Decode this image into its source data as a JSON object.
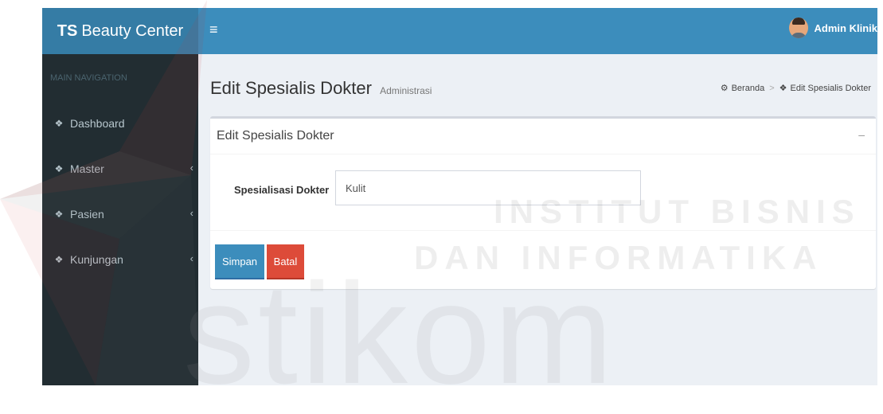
{
  "header": {
    "brand_bold": "TS",
    "brand_rest": "Beauty Center",
    "user_name": "Admin Klinik"
  },
  "sidebar": {
    "section_label": "MAIN NAVIGATION",
    "items": [
      {
        "label": "Dashboard",
        "has_submenu": false
      },
      {
        "label": "Master",
        "has_submenu": true
      },
      {
        "label": "Pasien",
        "has_submenu": true
      },
      {
        "label": "Kunjungan",
        "has_submenu": true
      }
    ]
  },
  "page": {
    "title": "Edit Spesialis Dokter",
    "subtitle": "Administrasi",
    "breadcrumb": [
      "Beranda",
      "Edit Spesialis Dokter"
    ]
  },
  "box": {
    "title": "Edit Spesialis Dokter",
    "tool": "–",
    "field_label": "Spesialisasi Dokter",
    "field_value": "Kulit",
    "save_label": "Simpan",
    "cancel_label": "Batal"
  },
  "watermark": {
    "line1": "INSTITUT BISNIS",
    "line2": "DAN INFORMATIKA",
    "logo_text": "stikom"
  },
  "colors": {
    "header": "#3c8dbc",
    "logo_bg": "#357ca5",
    "sidebar": "#222d32",
    "save": "#3c8dbc",
    "cancel": "#dd4b39"
  }
}
